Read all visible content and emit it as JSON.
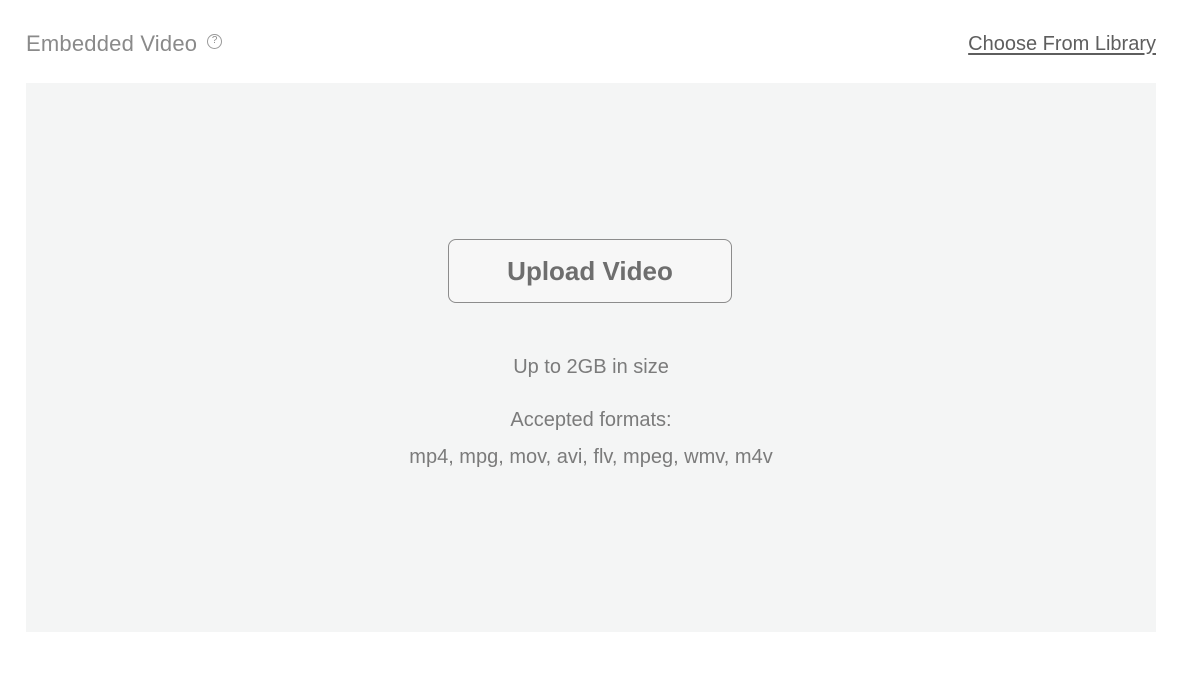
{
  "header": {
    "title": "Embedded Video",
    "help_icon": "question-circle-icon",
    "help_glyph": "?",
    "library_link": "Choose From Library"
  },
  "dropzone": {
    "upload_button": "Upload Video",
    "size_note": "Up to 2GB in size",
    "formats_label": "Accepted formats:",
    "formats_list": "mp4, mpg, mov, avi, flv, mpeg, wmv, m4v"
  },
  "colors": {
    "dropzone_bg": "#f4f5f5",
    "text_muted": "#7b7b7b",
    "button_border": "#8c8c8c"
  }
}
